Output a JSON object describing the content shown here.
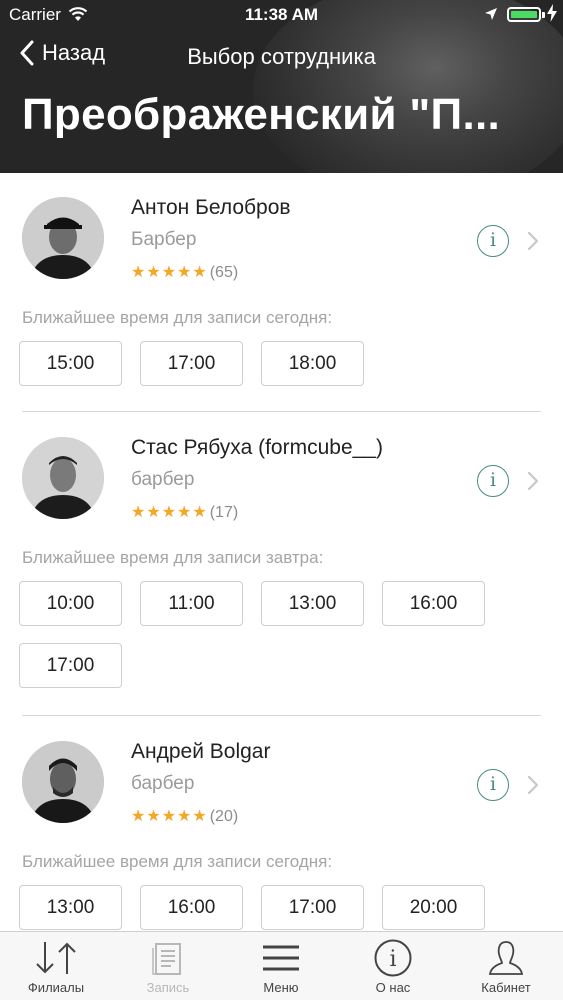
{
  "status_bar": {
    "carrier": "Carrier",
    "time": "11:38 AM"
  },
  "nav": {
    "back_label": "Назад",
    "title": "Выбор сотрудника"
  },
  "header": {
    "title": "Преображенский \"П..."
  },
  "employees": [
    {
      "name": "Антон Белобров",
      "role": "Барбер",
      "stars": "★★★★★",
      "rating": 5,
      "reviews": "(65)",
      "slots_label": "Ближайшее время для записи сегодня:",
      "slots": [
        "15:00",
        "17:00",
        "18:00"
      ]
    },
    {
      "name": "Стас Рябуха (formcube__)",
      "role": "барбер",
      "stars": "★★★★★",
      "rating": 5,
      "reviews": "(17)",
      "slots_label": "Ближайшее время для записи завтра:",
      "slots": [
        "10:00",
        "11:00",
        "13:00",
        "16:00",
        "17:00"
      ]
    },
    {
      "name": "Андрей Bolgar",
      "role": "барбер",
      "stars": "★★★★★",
      "rating": 5,
      "reviews": "(20)",
      "slots_label": "Ближайшее время для записи сегодня:",
      "slots": [
        "13:00",
        "16:00",
        "17:00",
        "20:00"
      ]
    }
  ],
  "tabbar": [
    {
      "label": "Филиалы",
      "icon": "branches-arrows-icon",
      "enabled": true
    },
    {
      "label": "Запись",
      "icon": "booking-document-icon",
      "enabled": false
    },
    {
      "label": "Меню",
      "icon": "menu-hamburger-icon",
      "enabled": true
    },
    {
      "label": "О нас",
      "icon": "info-circle-icon",
      "enabled": true
    },
    {
      "label": "Кабинет",
      "icon": "user-silhouette-icon",
      "enabled": true
    }
  ],
  "colors": {
    "accent": "#4a8a83",
    "stars": "#f5a623",
    "header_bg": "#262626",
    "battery": "#4cd964"
  }
}
